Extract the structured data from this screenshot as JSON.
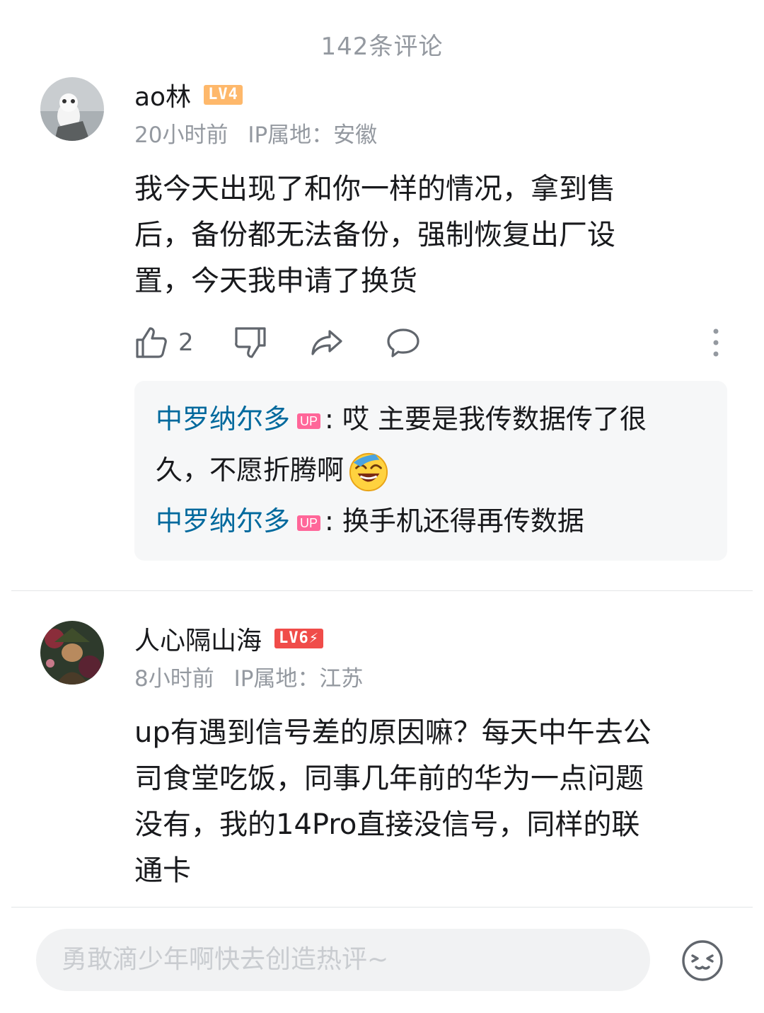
{
  "header": {
    "title": "142条评论"
  },
  "comments": [
    {
      "username": "ao林",
      "level": "LV4",
      "time": "20小时前",
      "ip": "IP属地：安徽",
      "lines": [
        "我今天出现了和你一样的情况，拿到售",
        "后，备份都无法备份，强制恢复出厂设",
        "置，今天我申请了换货"
      ],
      "likes": "2",
      "replies": [
        {
          "name": "中罗纳尔多",
          "badge": "UP",
          "sep": ":",
          "text1": " 哎 主要是我传数据传了很",
          "text2": "久，不愿折腾啊"
        },
        {
          "name": "中罗纳尔多",
          "badge": "UP",
          "sep": ":",
          "text1": " 换手机还得再传数据"
        }
      ]
    },
    {
      "username": "人心隔山海",
      "level": "LV6⚡",
      "time": "8小时前",
      "ip": "IP属地：江苏",
      "lines": [
        "up有遇到信号差的原因嘛？每天中午去公",
        "司食堂吃饭，同事几年前的华为一点问题",
        "没有，我的14Pro直接没信号，同样的联",
        "通卡"
      ]
    }
  ],
  "input": {
    "placeholder": "勇敢滴少年啊快去创造热评~"
  },
  "icons": [
    "like-icon",
    "dislike-icon",
    "share-icon",
    "reply-icon",
    "more-icon",
    "emoji-icon",
    "laughing-emoji-icon"
  ]
}
